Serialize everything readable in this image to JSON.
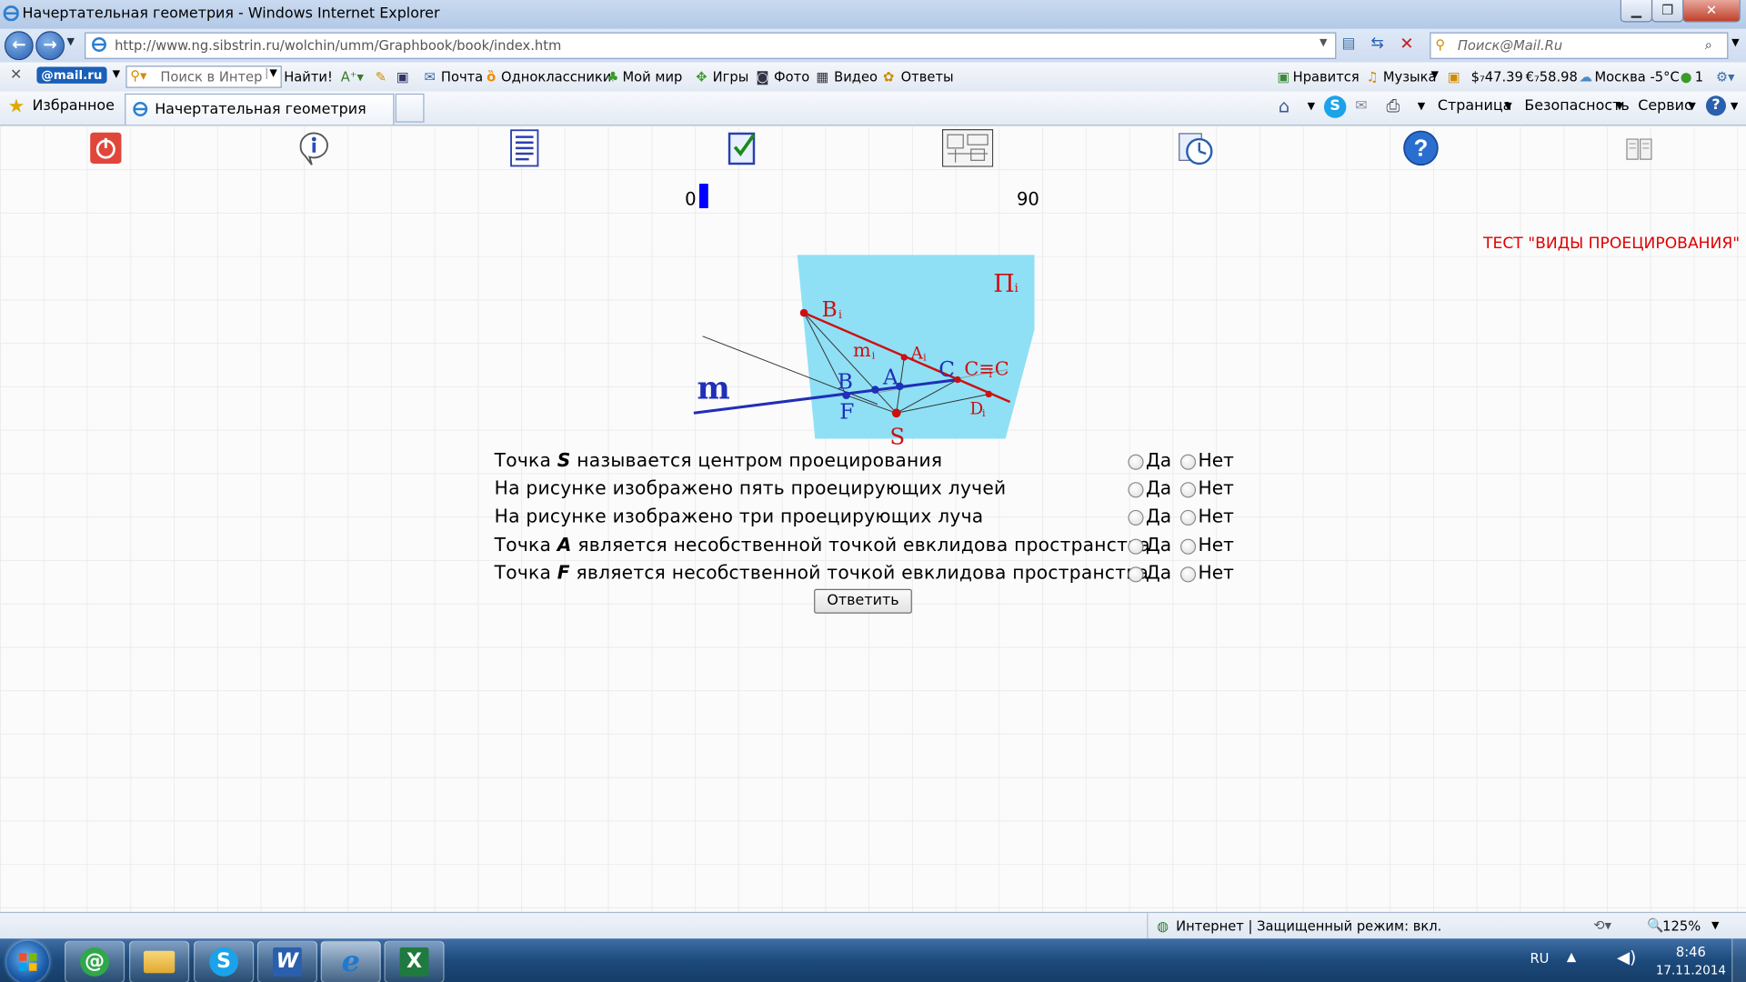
{
  "window": {
    "title": "Начертательная геометрия - Windows Internet Explorer",
    "minimize": "▁",
    "maximize": "❐",
    "close": "✕"
  },
  "address_bar": {
    "url": "http://www.ng.sibstrin.ru/wolchin/umm/Graphbook/book/index.htm",
    "search_placeholder": "Поиск@Mail.Ru"
  },
  "mail_toolbar": {
    "logo": "@mail.ru",
    "search_placeholder": "Поиск в Интерн",
    "find_button": "Найти!",
    "links": [
      "Почта",
      "Одноклассники",
      "Мой мир",
      "Игры",
      "Фото",
      "Видео",
      "Ответы"
    ],
    "likes": "Нравится",
    "music": "Музыка",
    "usd": "$₇47.39",
    "eur": "€₇58.98",
    "weather": "Москва -5°C",
    "count": "1"
  },
  "favorites_bar": {
    "favorites_label": "Избранное",
    "tab_title": "Начертательная геометрия",
    "menus": [
      "Страница",
      "Безопасность",
      "Сервис"
    ]
  },
  "page": {
    "progress_min": "0",
    "progress_max": "90",
    "progress_value": 0,
    "test_title": "ТЕСТ \"ВИДЫ ПРОЕЦИРОВАНИЯ\"",
    "answer_button": "Ответить",
    "yes_label": "Да",
    "no_label": "Нет",
    "questions": [
      {
        "before": "Точка ",
        "var": "S",
        "after": " называется центром проецирования"
      },
      {
        "before": "На рисунке изображено пять проецирующих лучей",
        "var": "",
        "after": ""
      },
      {
        "before": "На рисунке изображено три проецирующих луча",
        "var": "",
        "after": ""
      },
      {
        "before": "Точка ",
        "var": "A",
        "after": " является несобственной точкой евклидова пространства"
      },
      {
        "before": "Точка ",
        "var": "F",
        "after": " является несобственной точкой евклидова пространства"
      }
    ],
    "figure_labels": {
      "plane": "П",
      "plane_sub": "i",
      "line": "m",
      "line_i": "m",
      "B_i": "B",
      "A_i": "A",
      "C_i": "C≡C",
      "D_i": "D",
      "B": "B",
      "A": "A",
      "C": "C",
      "F": "F",
      "S": "S",
      "sub_i": "i"
    }
  },
  "status_bar": {
    "zone": "Интернет | Защищенный режим: вкл.",
    "zoom": "125%"
  },
  "taskbar": {
    "lang": "RU",
    "time": "8:46",
    "date": "17.11.2014"
  },
  "colors": {
    "test_title": "#e00000",
    "progress_bar": "#0000ff",
    "figure_plane": "#8fe0f5",
    "figure_red": "#cc1010",
    "figure_blue": "#1f2fb8"
  }
}
